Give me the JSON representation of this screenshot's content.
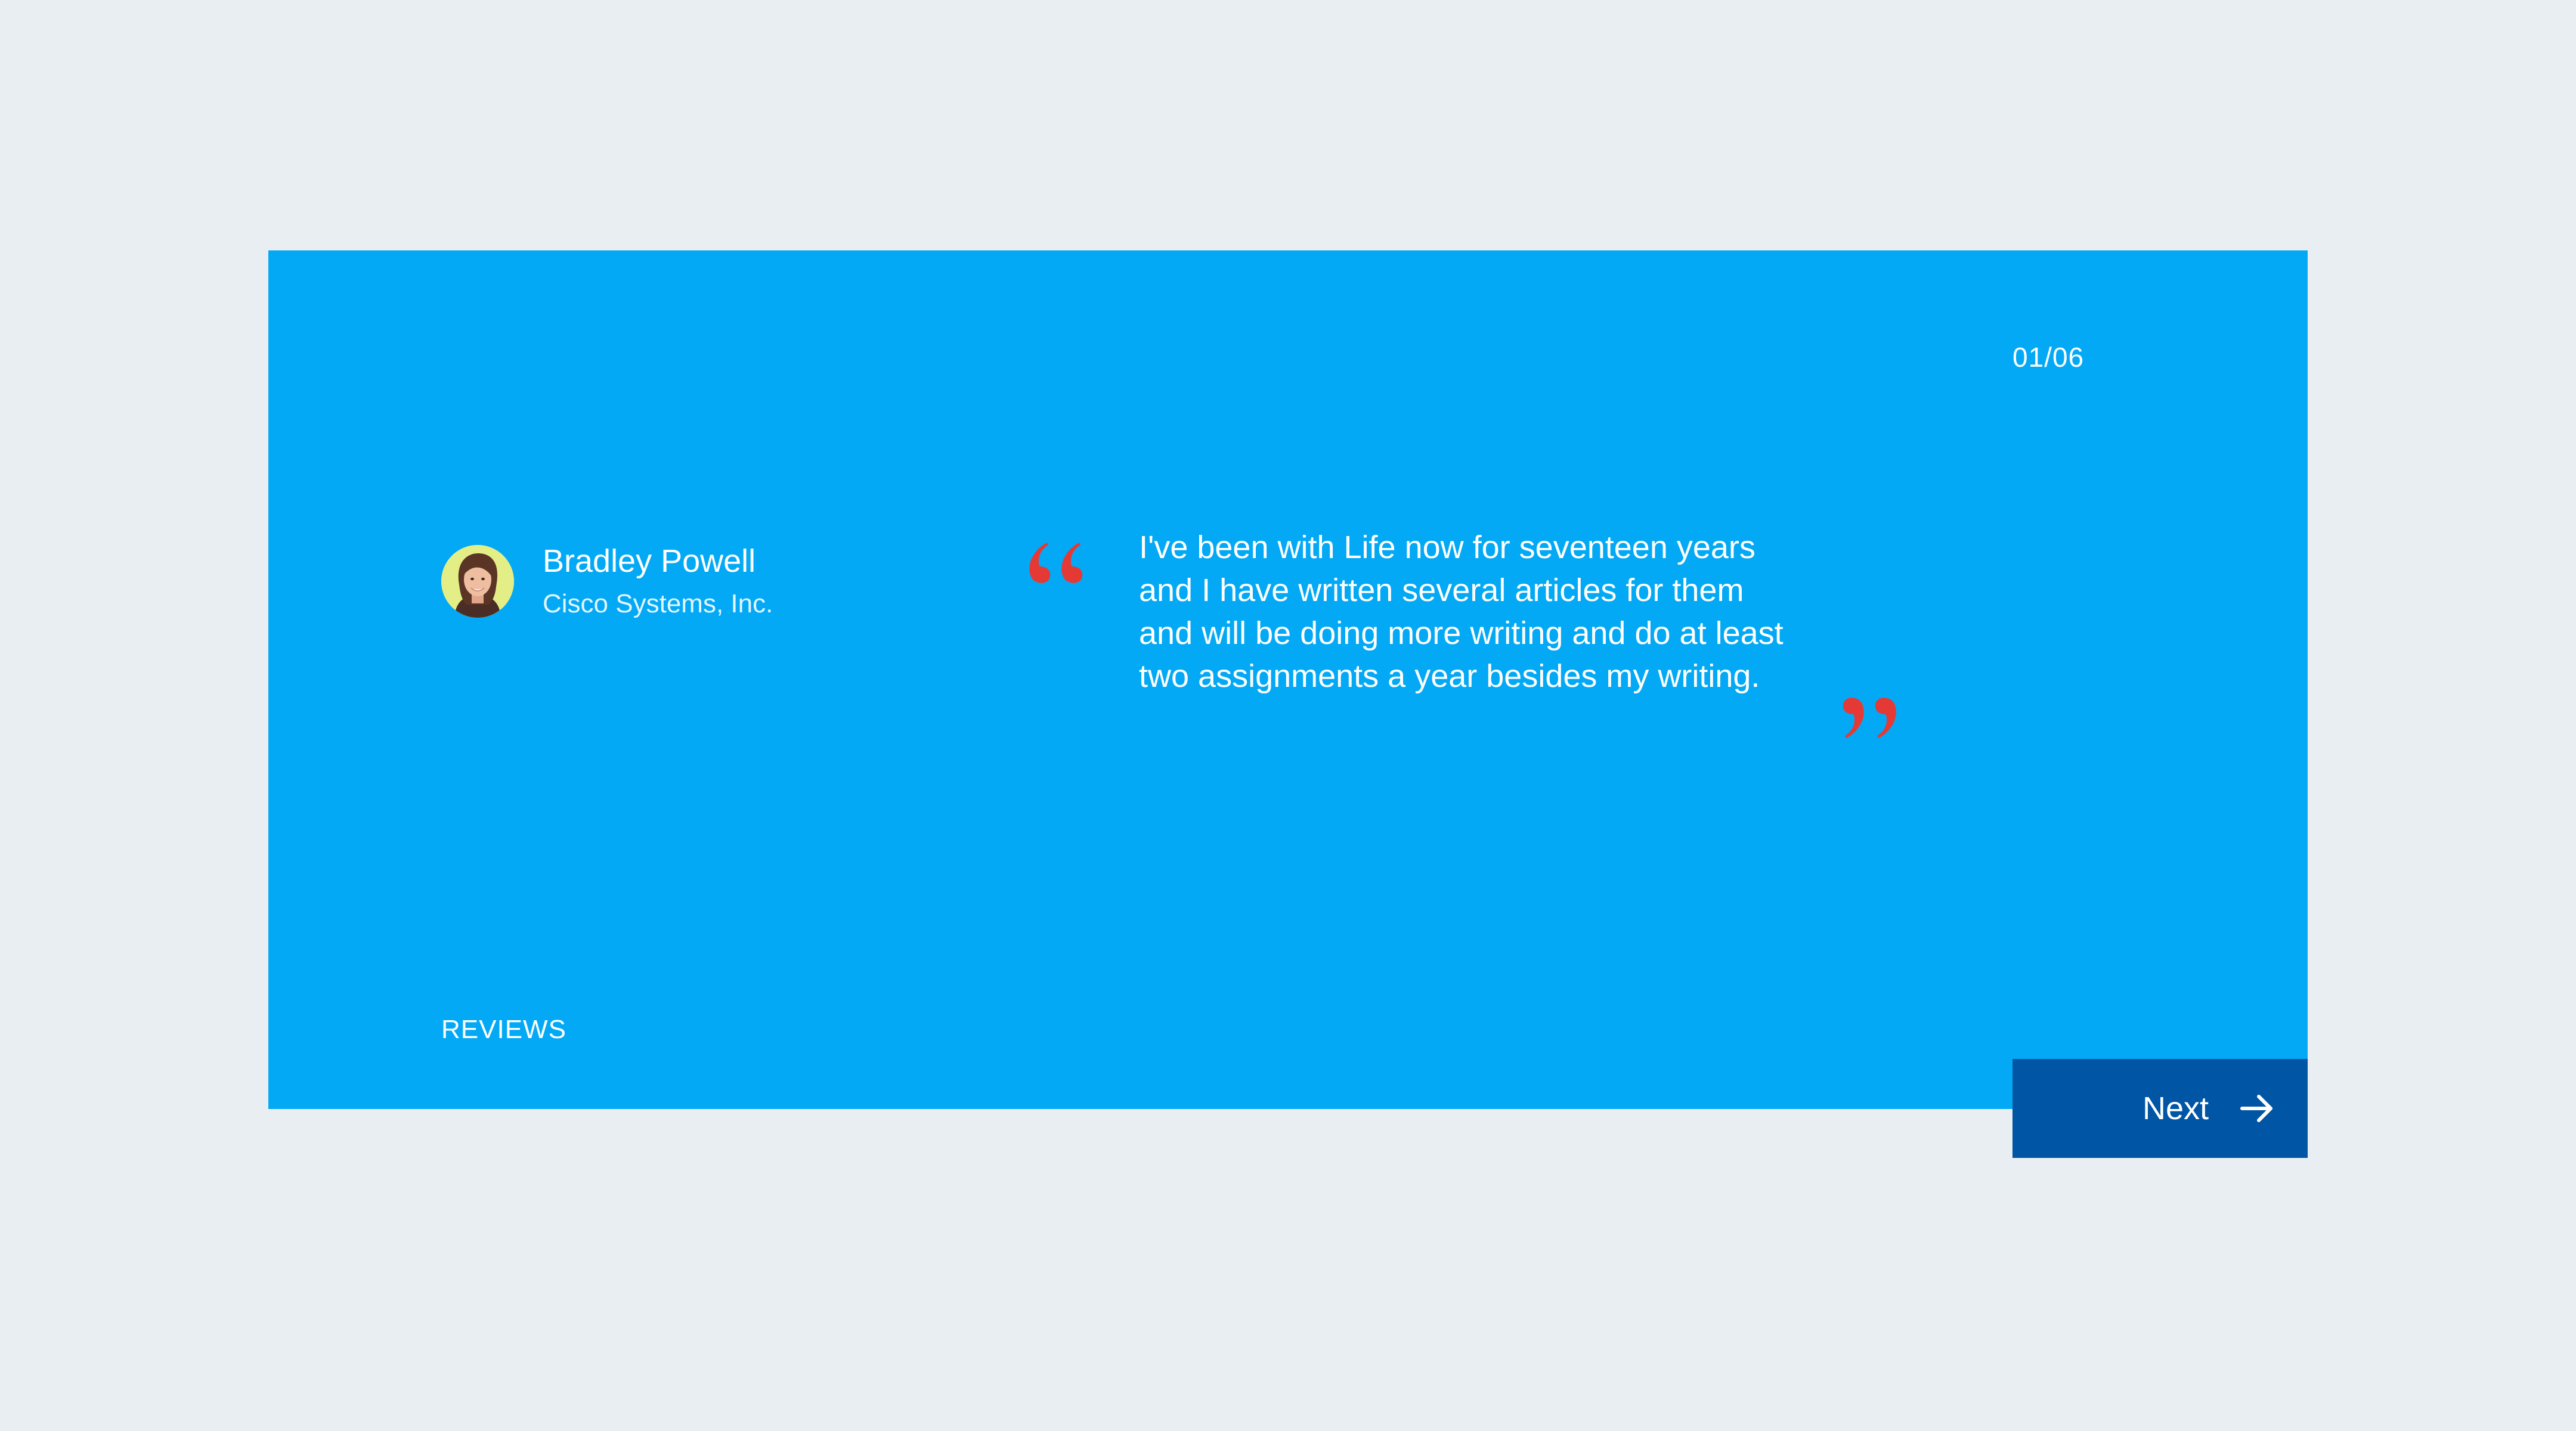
{
  "testimonial": {
    "counter": "01/06",
    "person": {
      "name": "Bradley Powell",
      "company": "Cisco Systems, Inc."
    },
    "quote": "I've been with Life now for seventeen years and I have written several articles for them and will be doing more writing and do at least two assignments a year besides my writing.",
    "section_label": "REVIEWS"
  },
  "navigation": {
    "next_label": "Next",
    "next_icon": "arrow-right-icon"
  },
  "colors": {
    "background": "#e9eef2",
    "card": "#03a9f4",
    "button": "#0055a5",
    "quote_marks": "#e53935",
    "text": "#ffffff"
  }
}
